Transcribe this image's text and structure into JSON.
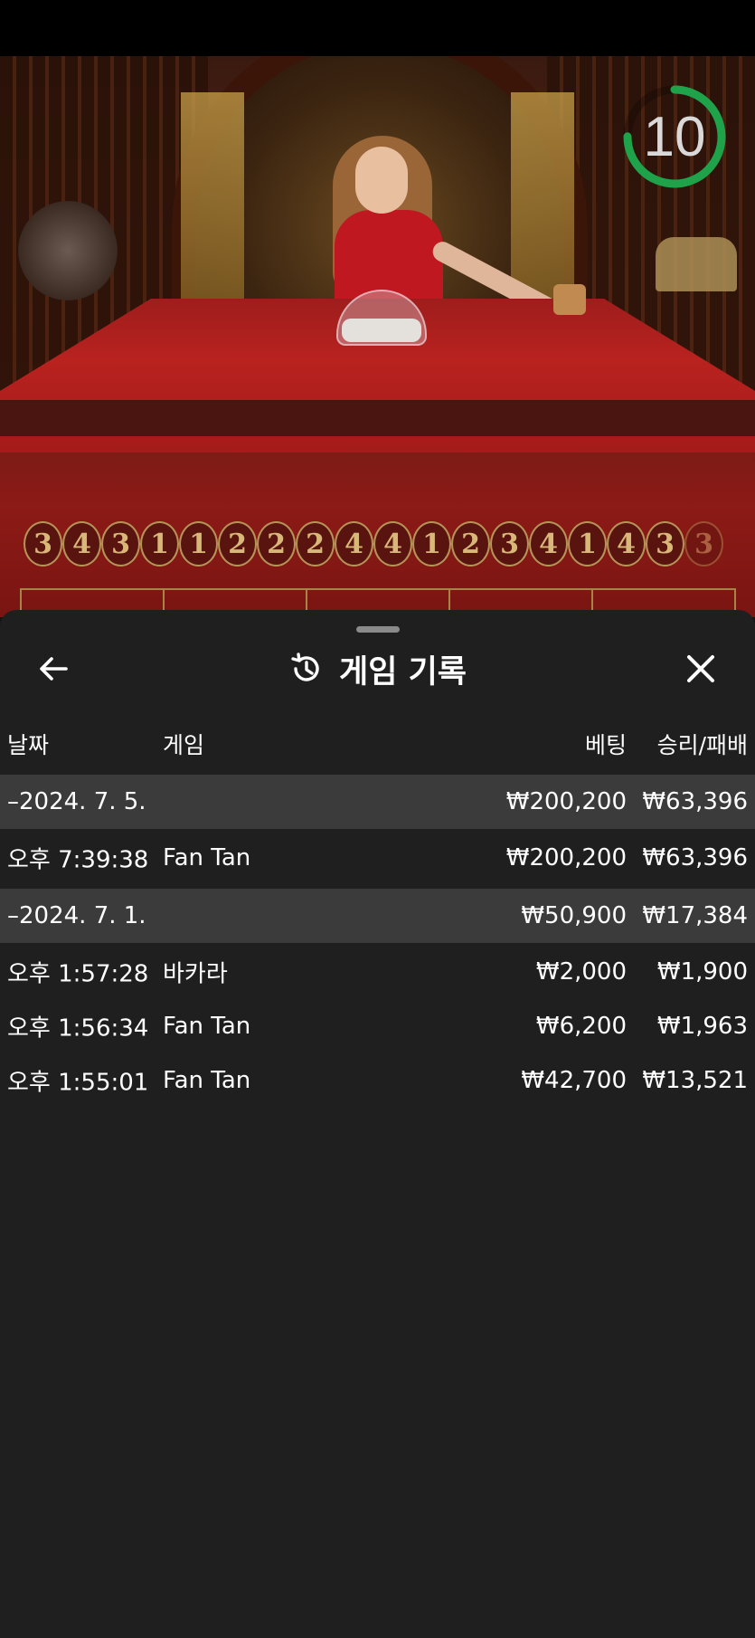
{
  "timer": {
    "value": "10",
    "progress": 0.75,
    "color": "#1fa34a"
  },
  "result_beads": [
    "3",
    "4",
    "3",
    "1",
    "1",
    "2",
    "2",
    "2",
    "4",
    "4",
    "1",
    "2",
    "3",
    "4",
    "1",
    "4",
    "3",
    "3"
  ],
  "sheet": {
    "title": "게임 기록",
    "icons": {
      "back": "arrow-left-icon",
      "history": "history-icon",
      "close": "close-icon"
    },
    "columns": {
      "date": "날짜",
      "game": "게임",
      "bet": "베팅",
      "winloss": "승리/패배"
    },
    "rows": [
      {
        "type": "date",
        "date": "–2024. 7. 5.",
        "game": "",
        "bet": "₩200,200",
        "winloss": "₩63,396"
      },
      {
        "type": "entry",
        "date": "오후 7:39:38",
        "game": "Fan Tan",
        "bet": "₩200,200",
        "winloss": "₩63,396"
      },
      {
        "type": "date",
        "date": "–2024. 7. 1.",
        "game": "",
        "bet": "₩50,900",
        "winloss": "₩17,384"
      },
      {
        "type": "entry",
        "date": "오후 1:57:28",
        "game": "바카라",
        "bet": "₩2,000",
        "winloss": "₩1,900"
      },
      {
        "type": "entry",
        "date": "오후 1:56:34",
        "game": "Fan Tan",
        "bet": "₩6,200",
        "winloss": "₩1,963"
      },
      {
        "type": "entry",
        "date": "오후 1:55:01",
        "game": "Fan Tan",
        "bet": "₩42,700",
        "winloss": "₩13,521"
      }
    ]
  },
  "colors": {
    "sheet_bg": "#1f1f1f",
    "date_row_bg": "#3b3b3b",
    "table_red": "#b8221f",
    "gold": "#b69458"
  }
}
